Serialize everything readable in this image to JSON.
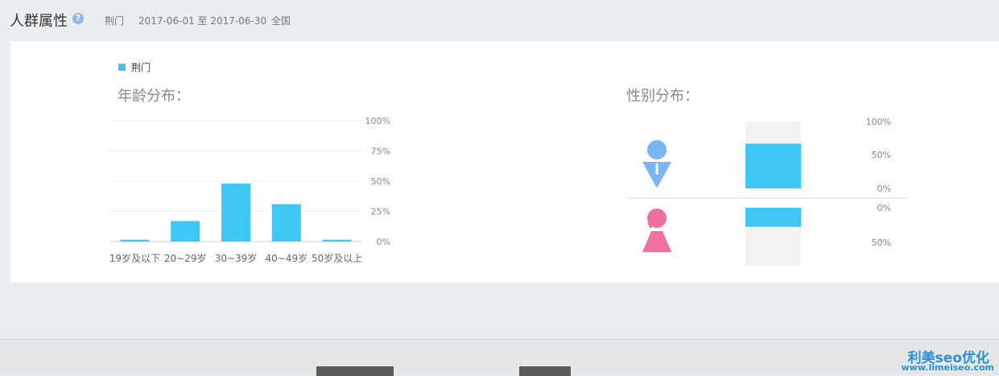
{
  "header": {
    "title": "人群属性",
    "help_icon": "question-circle-icon",
    "region": "荆门",
    "date_range": "2017-06-01 至 2017-06-30",
    "scope": "全国"
  },
  "legend": {
    "label": "荆门",
    "color": "#3fc8f5"
  },
  "age_section": {
    "title": "年龄分布："
  },
  "gender_section": {
    "title": "性别分布："
  },
  "chart_data": [
    {
      "type": "bar",
      "categories": [
        "19岁及以下",
        "20~29岁",
        "30~39岁",
        "40~49岁",
        "50岁及以上"
      ],
      "series": [
        {
          "name": "荆门",
          "values": [
            1.5,
            17,
            48,
            31,
            1.5
          ]
        }
      ],
      "ylim": [
        0,
        100
      ],
      "yticks": [
        "0%",
        "25%",
        "50%",
        "75%",
        "100%"
      ],
      "ytick_values": [
        0,
        25,
        50,
        75,
        100
      ],
      "grid": true,
      "color": "#3fc8f5"
    },
    {
      "type": "bar",
      "categories": [
        "男",
        "女"
      ],
      "series": [
        {
          "name": "荆门",
          "values": [
            67,
            33
          ]
        }
      ],
      "ylim": [
        0,
        100
      ],
      "male_ticks": [
        "100%",
        "50%",
        "0%"
      ],
      "female_ticks": [
        "0%",
        "50%"
      ],
      "male_icon": "male-person-icon",
      "female_icon": "female-person-icon",
      "male_color": "#7ab6f6",
      "female_color": "#ef6fa0",
      "color": "#3fc8f5"
    }
  ],
  "watermark": {
    "brand": "利美seo优化",
    "site": "www.limeiseo.com"
  }
}
